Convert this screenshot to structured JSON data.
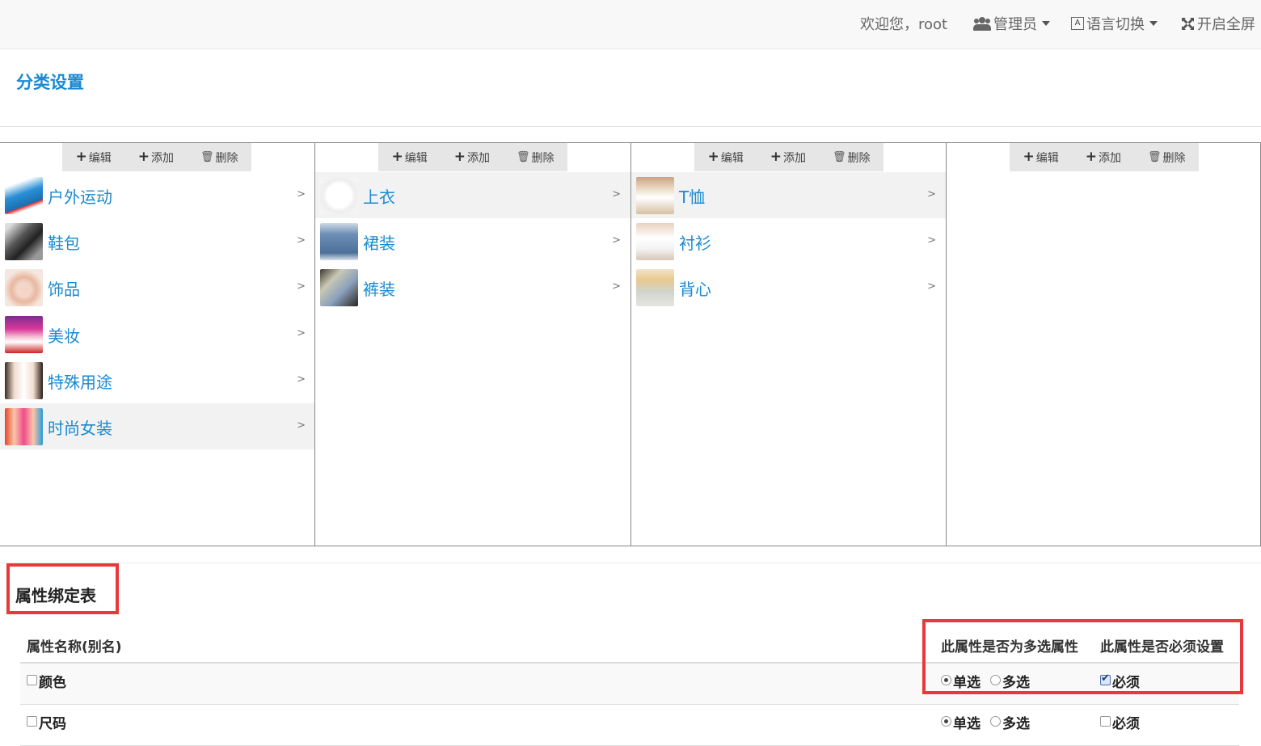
{
  "header": {
    "welcome": "欢迎您，root",
    "admin": "管理员",
    "language": "语言切换",
    "fullscreen": "开启全屏"
  },
  "page_title": "分类设置",
  "toolbar": {
    "edit": "编辑",
    "add": "添加",
    "delete": "删除"
  },
  "columns": [
    {
      "items": [
        {
          "name": "户外运动",
          "icon": "tent-image",
          "active": false
        },
        {
          "name": "鞋包",
          "icon": "shoes-image",
          "active": false
        },
        {
          "name": "饰品",
          "icon": "ring-image",
          "active": false
        },
        {
          "name": "美妆",
          "icon": "cosmetics-image",
          "active": false
        },
        {
          "name": "特殊用途",
          "icon": "costume-image",
          "active": false
        },
        {
          "name": "时尚女装",
          "icon": "women-fashion-image",
          "active": true
        }
      ]
    },
    {
      "items": [
        {
          "name": "上衣",
          "icon": "tshirt-image",
          "active": true
        },
        {
          "name": "裙装",
          "icon": "skirt-image",
          "active": false
        },
        {
          "name": "裤装",
          "icon": "pants-image",
          "active": false
        }
      ]
    },
    {
      "items": [
        {
          "name": "T恤",
          "icon": "tee-image",
          "active": true
        },
        {
          "name": "衬衫",
          "icon": "shirt-image",
          "active": false
        },
        {
          "name": "背心",
          "icon": "vest-image",
          "active": false
        }
      ]
    },
    {
      "items": []
    }
  ],
  "chevron": ">",
  "attr_table": {
    "title": "属性绑定表",
    "headers": {
      "name": "属性名称(别名)",
      "multi": "此属性是否为多选属性",
      "required": "此属性是否必须设置"
    },
    "single_label": "单选",
    "multi_label": "多选",
    "required_label": "必须",
    "rows": [
      {
        "name": "颜色",
        "checked": false,
        "mode": "single",
        "required": true
      },
      {
        "name": "尺码",
        "checked": false,
        "mode": "single",
        "required": false
      }
    ]
  }
}
